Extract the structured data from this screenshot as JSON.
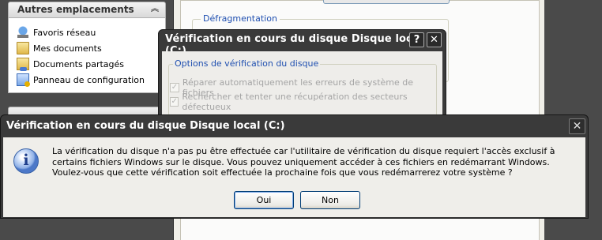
{
  "task_pane": {
    "header": "Autres emplacements",
    "items": [
      {
        "label": "Favoris réseau",
        "icon": "network-places-icon"
      },
      {
        "label": "Mes documents",
        "icon": "my-documents-icon"
      },
      {
        "label": "Documents partagés",
        "icon": "shared-documents-icon"
      },
      {
        "label": "Panneau de configuration",
        "icon": "control-panel-icon"
      }
    ]
  },
  "properties": {
    "defrag_label": "Défragmentation"
  },
  "check_dialog": {
    "title": "Vérification en cours du disque Disque local (C:)",
    "help_label": "?",
    "close_label": "✕",
    "group_label": "Options de vérification du disque",
    "options": [
      {
        "label": "Réparer automatiquement les erreurs de système de fichiers",
        "checked": true
      },
      {
        "label": "Rechercher et tenter une récupération des secteurs défectueux",
        "checked": true
      }
    ]
  },
  "message_dialog": {
    "title": "Vérification en cours du disque Disque local (C:)",
    "close_label": "✕",
    "icon": "information-icon",
    "message": "La vérification du disque n'a pas pu être effectuée car l'utilitaire de vérification du disque requiert l'accès exclusif à certains fichiers Windows sur le disque. Vous pouvez uniquement accéder à ces fichiers en redémarrant Windows. Voulez-vous que cette vérification soit effectuée la prochaine fois que vous redémarrerez votre système ?",
    "yes_label": "Oui",
    "no_label": "Non"
  },
  "colors": {
    "title_bar": "#3a3a3a",
    "group_label": "#1f4fb0",
    "default_button_border": "#003c74"
  }
}
